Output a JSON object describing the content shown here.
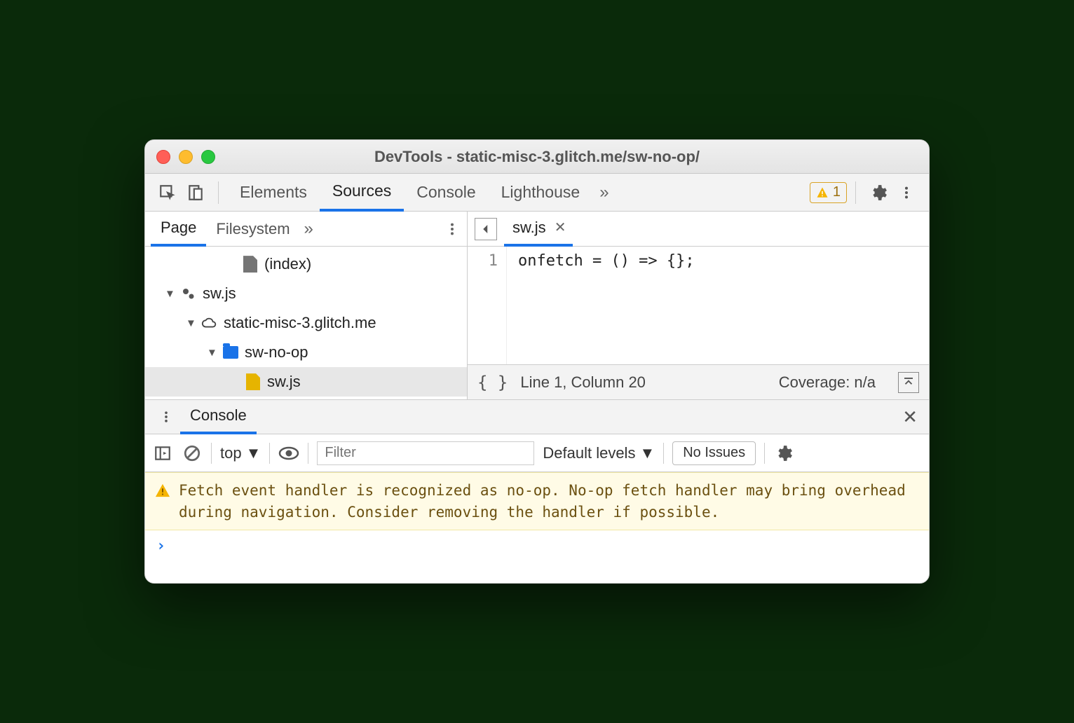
{
  "window": {
    "title": "DevTools - static-misc-3.glitch.me/sw-no-op/"
  },
  "mainTabs": {
    "elements": "Elements",
    "sources": "Sources",
    "console": "Console",
    "lighthouse": "Lighthouse"
  },
  "warnBadge": {
    "count": "1"
  },
  "sourcesPane": {
    "tabs": {
      "page": "Page",
      "filesystem": "Filesystem"
    },
    "tree": {
      "indexLabel": "(index)",
      "swWorker": "sw.js",
      "domain": "static-misc-3.glitch.me",
      "folder": "sw-no-op",
      "file": "sw.js"
    }
  },
  "editor": {
    "openFile": "sw.js",
    "lineNo": "1",
    "code": "onfetch = () => {};",
    "status": {
      "position": "Line 1, Column 20",
      "coverage": "Coverage: n/a"
    }
  },
  "drawer": {
    "tab": "Console"
  },
  "consoleBar": {
    "context": "top",
    "filterPlaceholder": "Filter",
    "levels": "Default levels",
    "issues": "No Issues"
  },
  "consoleMsg": {
    "warning": "Fetch event handler is recognized as no-op. No-op fetch handler may bring overhead during navigation. Consider removing the handler if possible."
  }
}
